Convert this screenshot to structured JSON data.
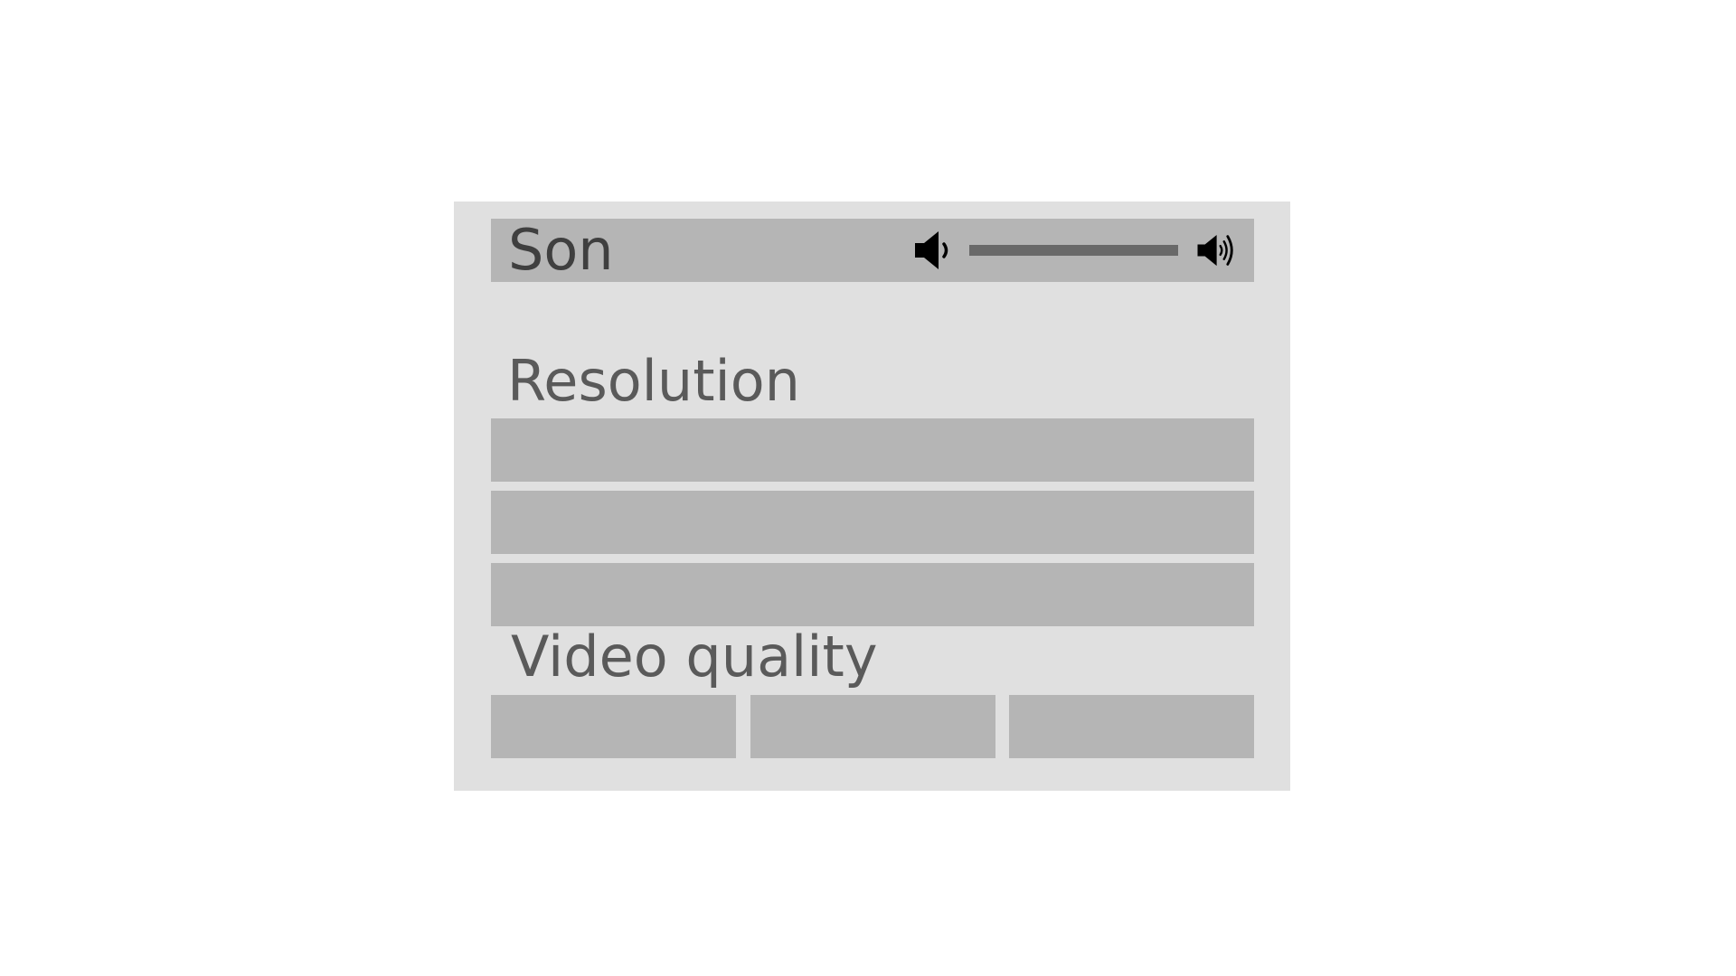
{
  "settings": {
    "sound": {
      "label": "Son",
      "volume_level": 1.0,
      "icons": {
        "low": "volume-low-icon",
        "high": "volume-high-icon"
      }
    },
    "resolution": {
      "title": "Resolution",
      "options": [
        "",
        "",
        ""
      ]
    },
    "video_quality": {
      "title": "Video quality",
      "options": [
        "",
        "",
        ""
      ]
    }
  },
  "colors": {
    "panel": "#e0e0e0",
    "row": "#b5b5b5",
    "slider_fill": "#696969",
    "icon": "#000000",
    "title_text": "#5a5a5a",
    "sound_text": "#3f3f3f"
  }
}
